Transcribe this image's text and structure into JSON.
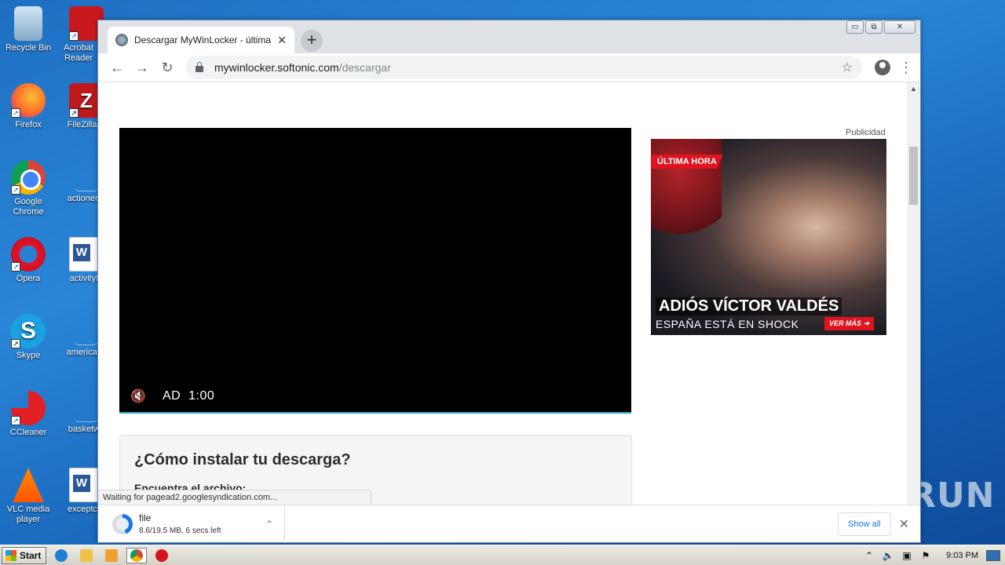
{
  "desktop": {
    "icons": [
      {
        "label": "Recycle Bin"
      },
      {
        "label": "Acrobat Reader"
      },
      {
        "label": "Firefox"
      },
      {
        "label": "FileZilla C"
      },
      {
        "label": "Google Chrome"
      },
      {
        "label": "actionerro"
      },
      {
        "label": "Opera"
      },
      {
        "label": "activityfa"
      },
      {
        "label": "Skype"
      },
      {
        "label": "americanc"
      },
      {
        "label": "CCleaner"
      },
      {
        "label": "basketwo"
      },
      {
        "label": "VLC media player"
      },
      {
        "label": "exceptcor"
      }
    ]
  },
  "browser": {
    "tab_title": "Descargar MyWinLocker - última ver",
    "tab_close": "✕",
    "new_tab": "+",
    "url_host": "mywinlocker.softonic.com",
    "url_path": "/descargar",
    "controls": {
      "minimize": "▭",
      "maximize": "⧉",
      "close": "✕"
    },
    "nav": {
      "back": "←",
      "forward": "→",
      "reload": "↻",
      "star": "☆",
      "menu": "⋮"
    }
  },
  "page": {
    "video": {
      "mute_icon": "🔇",
      "ad_text": "AD  1:00"
    },
    "publicidad": "Publicidad",
    "ad": {
      "badge": "ÚLTIMA HORA",
      "headline": "ADIÓS VÍCTOR VALDÉS",
      "subline": "ESPAÑA ESTÁ EN SHOCK",
      "cta": "VER MÁS ➜"
    },
    "install": {
      "heading": "¿Cómo instalar tu descarga?",
      "step": "Encuentra el archivo:"
    }
  },
  "status_bubble": "Waiting for pagead2.googlesyndication.com...",
  "download": {
    "name": "file",
    "status": "8.6/19.5 MB, 6 secs left",
    "show_all": "Show all",
    "close": "✕"
  },
  "watermark": "ANY RUN",
  "taskbar": {
    "start": "Start",
    "clock": "9:03 PM"
  }
}
